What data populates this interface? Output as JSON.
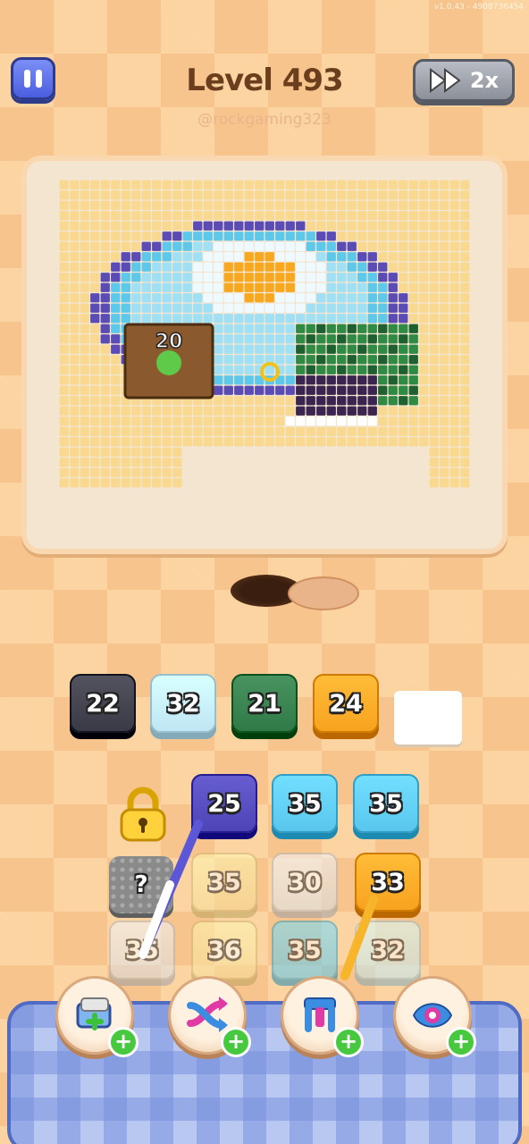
{
  "version": "v1.0.43 - 4908736454",
  "header": {
    "level_title": "Level 493",
    "username": "@rockgaming323",
    "speed_label": "2x"
  },
  "pixel_block_label": "20",
  "slots": [
    {
      "value": "22",
      "color": "#3a3a47"
    },
    {
      "value": "32",
      "color": "#bfe6f4"
    },
    {
      "value": "21",
      "color": "#2f7a46"
    },
    {
      "value": "24",
      "color": "#f7a31f"
    }
  ],
  "grid": {
    "row1": [
      {
        "value": "25",
        "color": "#4d44b8"
      },
      {
        "value": "35",
        "color": "#59c6ee"
      },
      {
        "value": "35",
        "color": "#59c6ee"
      }
    ],
    "row2": [
      {
        "value": "35",
        "color": "#f7df9a"
      },
      {
        "value": "30",
        "color": "#d9dde3"
      },
      {
        "value": "33",
        "color": "#f7a31f"
      }
    ],
    "row3": [
      {
        "value": "35",
        "color": "#d9dde3"
      },
      {
        "value": "36",
        "color": "#f7df9a"
      },
      {
        "value": "35",
        "color": "#59c6ee"
      },
      {
        "value": "32",
        "color": "#bfe6f4"
      }
    ],
    "mystery_label": "?"
  },
  "boosters": [
    {
      "name": "add-slot-icon"
    },
    {
      "name": "shuffle-icon"
    },
    {
      "name": "magnet-claw-icon"
    },
    {
      "name": "eye-reveal-icon"
    }
  ]
}
